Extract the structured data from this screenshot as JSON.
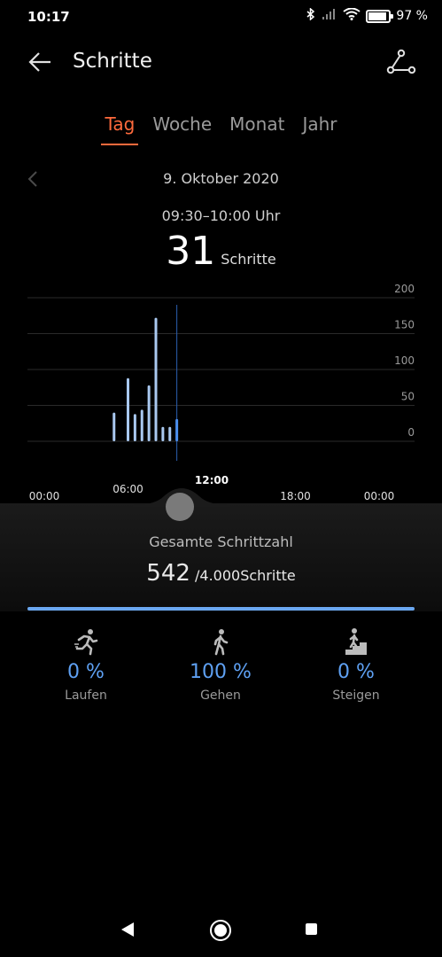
{
  "status": {
    "time": "10:17",
    "battery": "97 %",
    "battery_level": 0.97
  },
  "header": {
    "title": "Schritte"
  },
  "tabs": [
    "Tag",
    "Woche",
    "Monat",
    "Jahr"
  ],
  "active_tab": "Tag",
  "date": "9. Oktober 2020",
  "range": "09:30–10:00 Uhr",
  "selected": {
    "value": "31",
    "unit": "Schritte"
  },
  "chart_data": {
    "type": "bar",
    "y_ticks": [
      "200",
      "150",
      "100",
      "50",
      "0"
    ],
    "ylim": [
      0,
      200
    ],
    "x_ticks": [
      "00:00",
      "06:00",
      "12:00",
      "18:00",
      "00:00"
    ],
    "x_tick_hours": [
      0,
      6,
      12,
      18,
      24
    ],
    "bars": [
      {
        "hour": 5.0,
        "value": 40
      },
      {
        "hour": 6.0,
        "value": 88
      },
      {
        "hour": 6.5,
        "value": 38
      },
      {
        "hour": 7.0,
        "value": 44
      },
      {
        "hour": 7.5,
        "value": 78
      },
      {
        "hour": 8.0,
        "value": 172
      },
      {
        "hour": 8.5,
        "value": 20
      },
      {
        "hour": 9.0,
        "value": 20
      },
      {
        "hour": 9.5,
        "value": 31,
        "selected": true
      }
    ],
    "grid": true,
    "colors": {
      "bar": "#a9c8f0",
      "selected": "#4b8ff0",
      "grid": "#2a2a2a"
    }
  },
  "summary": {
    "label": "Gesamte Schrittzahl",
    "value": "542",
    "goal": " /4.000Schritte",
    "progress": 1.0
  },
  "stats": [
    {
      "pct": "0 %",
      "label": "Laufen",
      "icon": "running-icon"
    },
    {
      "pct": "100 %",
      "label": "Gehen",
      "icon": "walking-icon"
    },
    {
      "pct": "0 %",
      "label": "Steigen",
      "icon": "climbing-icon"
    }
  ],
  "colors": {
    "accent": "#ff6a3c",
    "blue": "#5ea0f2"
  }
}
